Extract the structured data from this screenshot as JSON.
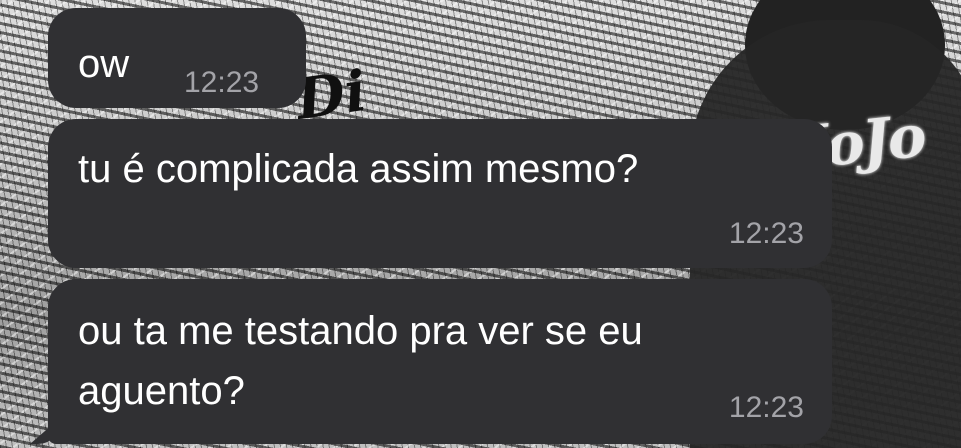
{
  "chat": {
    "messages": [
      {
        "text": "ow",
        "time": "12:23"
      },
      {
        "text": "tu é complicada assim mesmo?",
        "time": "12:23"
      },
      {
        "text": "ou ta me testando pra ver se eu aguento?",
        "time": "12:23"
      }
    ]
  },
  "wallpaper": {
    "sign_text": "Di",
    "shirt_text": "JoJo"
  },
  "colors": {
    "bubble": "#303033",
    "message_text": "#ffffff",
    "timestamp": "#a3a3a8"
  }
}
